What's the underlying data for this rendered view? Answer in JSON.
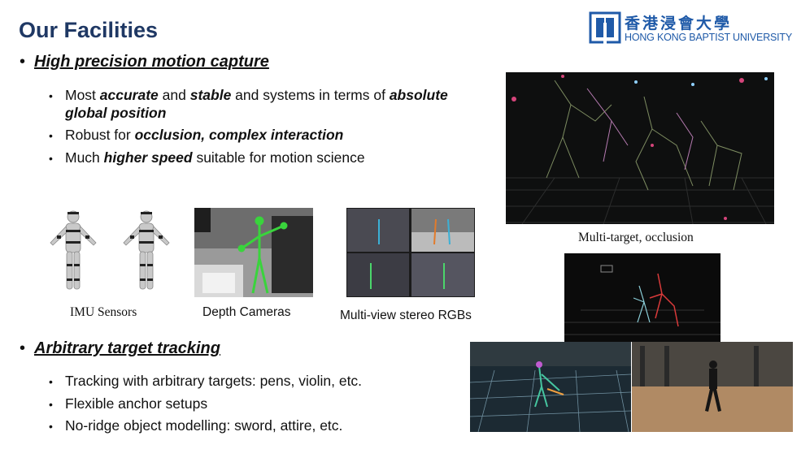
{
  "title": "Our Facilities",
  "logo": {
    "chinese": "香港浸會大學",
    "english": "HONG KONG BAPTIST UNIVERSITY",
    "brand_color": "#1f5aa8"
  },
  "section1": {
    "heading": "High precision motion capture",
    "items": [
      {
        "parts": [
          "Most ",
          "accurate",
          " and ",
          "stable",
          " and systems in terms of ",
          "absolute"
        ],
        "line2": "global position"
      },
      {
        "parts": [
          "Robust for ",
          "occlusion, complex interaction"
        ]
      },
      {
        "parts": [
          "Much ",
          "higher speed",
          " suitable for motion science"
        ]
      }
    ]
  },
  "figures": {
    "imu": "IMU Sensors",
    "depth": "Depth Cameras",
    "stereo": "Multi-view stereo RGBs",
    "multitarget": "Multi-target, occlusion"
  },
  "section2": {
    "heading": "Arbitrary target tracking",
    "items": [
      "Tracking with arbitrary targets: pens, violin, etc.",
      "Flexible anchor setups",
      "No-ridge object modelling: sword, attire, etc."
    ]
  },
  "colors": {
    "title": "#1f3864",
    "text": "#111111"
  }
}
